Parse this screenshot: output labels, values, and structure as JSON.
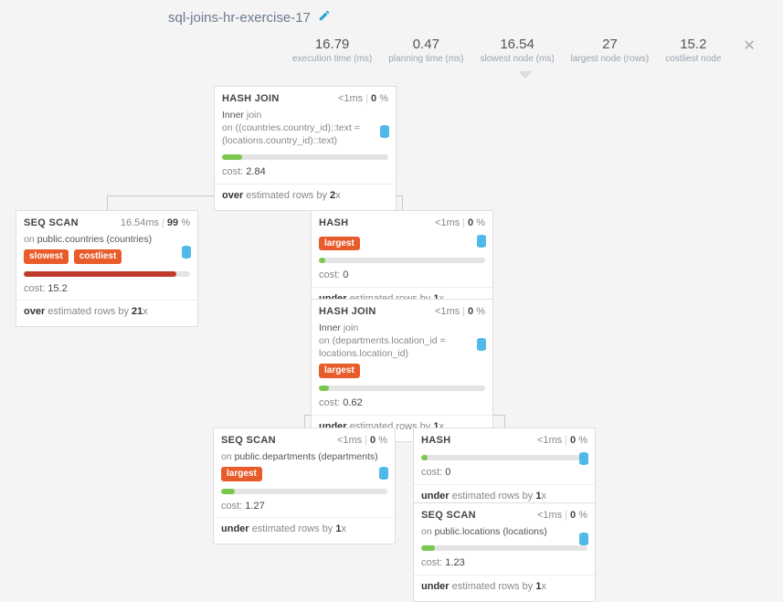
{
  "title": "sql-joins-hr-exercise-17",
  "metrics": {
    "exec_val": "16.79",
    "exec_lbl": "execution time (ms)",
    "plan_val": "0.47",
    "plan_lbl": "planning time (ms)",
    "slow_val": "16.54",
    "slow_lbl": "slowest node (ms)",
    "large_val": "27",
    "large_lbl": "largest node (rows)",
    "cost_val": "15.2",
    "cost_lbl": "costliest node"
  },
  "nodes": {
    "hashjoin1": {
      "title": "HASH JOIN",
      "time": "<1ms",
      "pct": "0",
      "desc_pre": "Inner ",
      "desc_kw": "join",
      "desc_on": "on ((countries.country_id)::text = (locations.country_id)::text)",
      "cost": "2.84",
      "est_pre": "over",
      "est_mid": " estimated rows by ",
      "est_fac": "2",
      "est_suf": "x"
    },
    "seqscan_countries": {
      "title": "SEQ SCAN",
      "time": "16.54ms",
      "pct": "99",
      "on_pre": "on ",
      "on_val": "public.countries (countries)",
      "badge1": "slowest",
      "badge2": "costliest",
      "cost": "15.2",
      "est_pre": "over",
      "est_mid": " estimated rows by ",
      "est_fac": "21",
      "est_suf": "x"
    },
    "hash1": {
      "title": "HASH",
      "time": "<1ms",
      "pct": "0",
      "badge": "largest",
      "cost": "0",
      "est_pre": "under",
      "est_mid": " estimated rows by ",
      "est_fac": "1",
      "est_suf": "x"
    },
    "hashjoin2": {
      "title": "HASH JOIN",
      "time": "<1ms",
      "pct": "0",
      "desc_pre": "Inner ",
      "desc_kw": "join",
      "desc_on": "on (departments.location_id = locations.location_id)",
      "badge": "largest",
      "cost": "0.62",
      "est_pre": "under",
      "est_mid": " estimated rows by ",
      "est_fac": "1",
      "est_suf": "x"
    },
    "seqscan_departments": {
      "title": "SEQ SCAN",
      "time": "<1ms",
      "pct": "0",
      "on_pre": "on ",
      "on_val": "public.departments (departments)",
      "badge": "largest",
      "cost": "1.27",
      "est_pre": "under",
      "est_mid": " estimated rows by ",
      "est_fac": "1",
      "est_suf": "x"
    },
    "hash2": {
      "title": "HASH",
      "time": "<1ms",
      "pct": "0",
      "cost": "0",
      "est_pre": "under",
      "est_mid": " estimated rows by ",
      "est_fac": "1",
      "est_suf": "x"
    },
    "seqscan_locations": {
      "title": "SEQ SCAN",
      "time": "<1ms",
      "pct": "0",
      "on_pre": "on ",
      "on_val": "public.locations (locations)",
      "cost": "1.23",
      "est_pre": "under",
      "est_mid": " estimated rows by ",
      "est_fac": "1",
      "est_suf": "x"
    }
  },
  "labels": {
    "cost_prefix": "cost: "
  }
}
